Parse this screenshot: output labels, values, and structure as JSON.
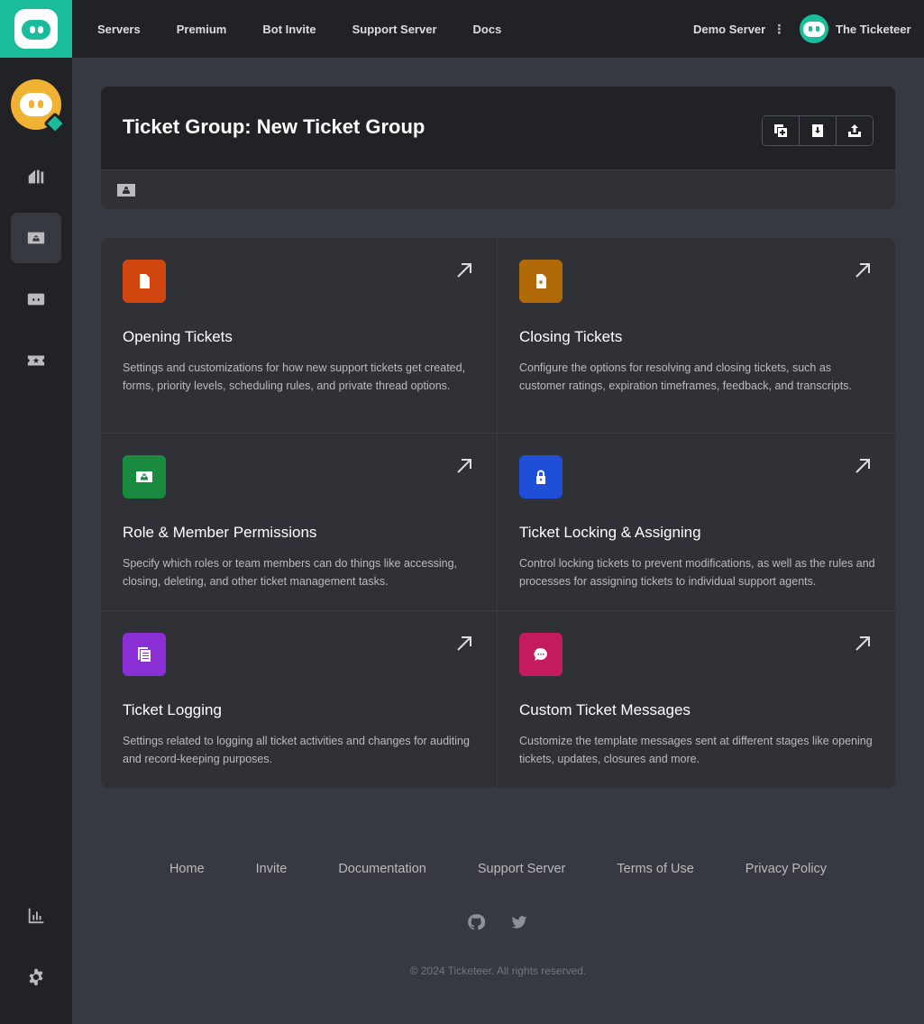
{
  "nav": {
    "items": [
      "Servers",
      "Premium",
      "Bot Invite",
      "Support Server",
      "Docs"
    ],
    "server_name": "Demo Server",
    "kebab": "⋮",
    "user_name": "The Ticketeer"
  },
  "header": {
    "title": "Ticket Group: New Ticket Group"
  },
  "cards": [
    {
      "title": "Opening Tickets",
      "description": "Settings and customizations for how new support tickets get created, forms, priority levels, scheduling rules, and private thread options.",
      "icon": "file-icon",
      "color": "#d1450f"
    },
    {
      "title": "Closing Tickets",
      "description": "Configure the options for resolving and closing tickets, such as customer ratings, expiration timeframes, feedback, and transcripts.",
      "icon": "file-x-icon",
      "color": "#b06a0a"
    },
    {
      "title": "Role & Member Permissions",
      "description": "Specify which roles or team members can do things like accessing, closing, deleting, and other ticket management tasks.",
      "icon": "id-card-icon",
      "color": "#1a8a3e"
    },
    {
      "title": "Ticket Locking & Assigning",
      "description": "Control locking tickets to prevent modifications, as well as the rules and processes for assigning tickets to individual support agents.",
      "icon": "lock-icon",
      "color": "#1f4fd6"
    },
    {
      "title": "Ticket Logging",
      "description": "Settings related to logging all ticket activities and changes for auditing and record-keeping purposes.",
      "icon": "logs-icon",
      "color": "#8a2fd6"
    },
    {
      "title": "Custom Ticket Messages",
      "description": "Customize the template messages sent at different stages like opening tickets, updates, closures and more.",
      "icon": "chat-bubble-icon",
      "color": "#c41a5e"
    }
  ],
  "footer": {
    "links": [
      "Home",
      "Invite",
      "Documentation",
      "Support Server",
      "Terms of Use",
      "Privacy Policy"
    ],
    "copyright": "© 2024 Ticketeer. All rights reserved."
  },
  "colors": {
    "accent": "#1abc9c",
    "guild": "#f0b232",
    "background": "#36393f",
    "sidebar": "#202225",
    "card": "#2f3136"
  }
}
